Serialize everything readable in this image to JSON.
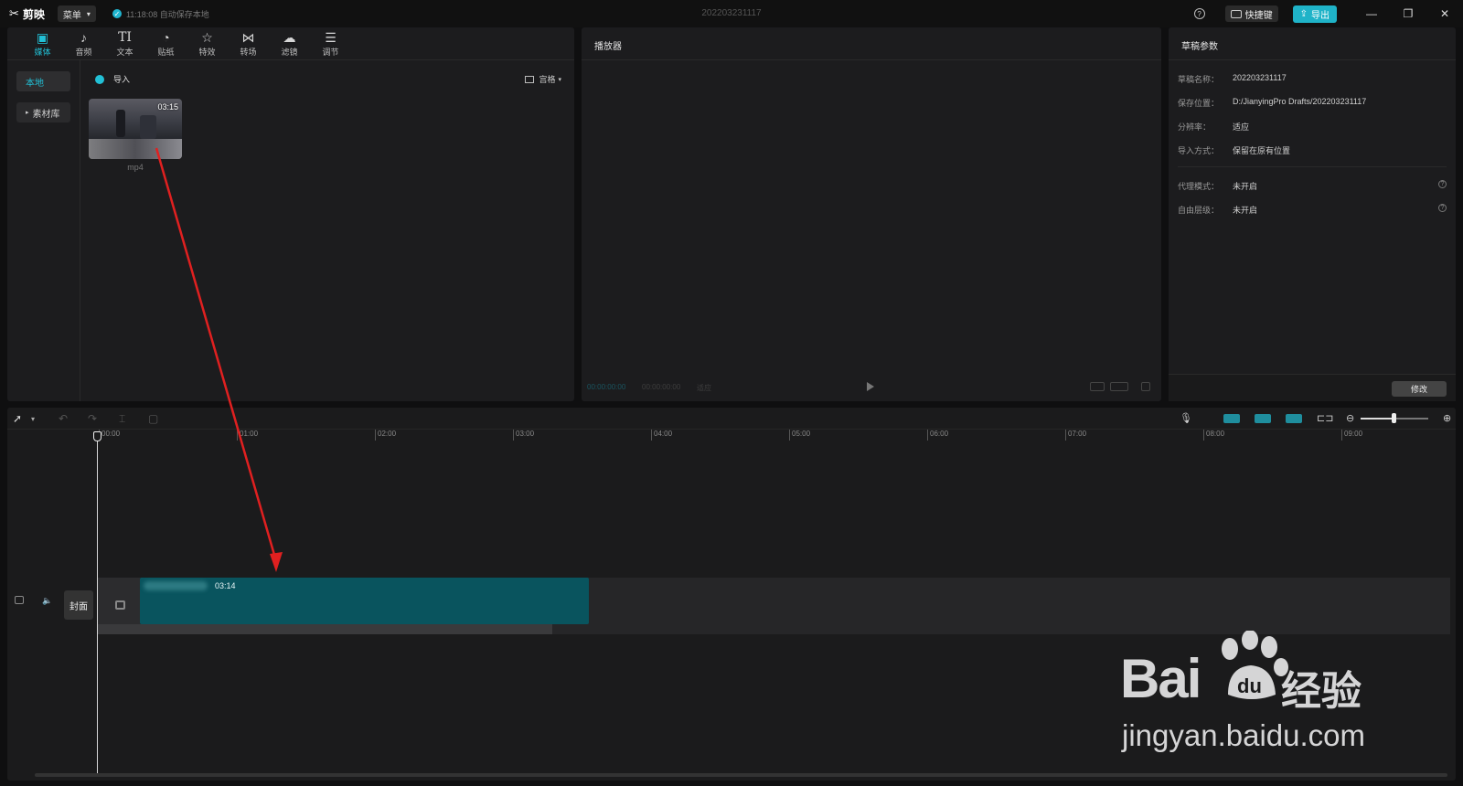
{
  "titlebar": {
    "app_name": "剪映",
    "menu_label": "菜单",
    "autosave_text": "11:18:08 自动保存本地",
    "doc_title": "202203231117",
    "shortcut_label": "快捷键",
    "export_label": "导出"
  },
  "toolbar": {
    "tabs": [
      {
        "label": "媒体",
        "icon": "media-icon"
      },
      {
        "label": "音频",
        "icon": "audio-icon"
      },
      {
        "label": "文本",
        "icon": "text-icon"
      },
      {
        "label": "贴纸",
        "icon": "sticker-icon"
      },
      {
        "label": "特效",
        "icon": "effects-icon"
      },
      {
        "label": "转场",
        "icon": "transition-icon"
      },
      {
        "label": "滤镜",
        "icon": "filter-icon"
      },
      {
        "label": "调节",
        "icon": "adjust-icon"
      }
    ]
  },
  "media": {
    "side_local": "本地",
    "side_library": "素材库",
    "import_label": "导入",
    "view_label": "宫格",
    "clip_duration": "03:15",
    "clip_name": "mp4"
  },
  "player": {
    "title": "播放器",
    "time_current": "00:00:00:00",
    "time_total": "00:00:00:00",
    "ratio_label": "适应"
  },
  "draft": {
    "title": "草稿参数",
    "fields": [
      {
        "key": "草稿名称：",
        "value": "202203231117"
      },
      {
        "key": "保存位置：",
        "value": "D:/JianyingPro Drafts/202203231117"
      },
      {
        "key": "分辨率：",
        "value": "适应"
      },
      {
        "key": "导入方式：",
        "value": "保留在原有位置"
      },
      {
        "key": "代理模式：",
        "value": "未开启"
      },
      {
        "key": "自由层级：",
        "value": "未开启"
      }
    ],
    "modify_label": "修改"
  },
  "timeline": {
    "ticks": [
      "00:00",
      "01:00",
      "02:00",
      "03:00",
      "04:00",
      "05:00",
      "06:00",
      "07:00",
      "08:00",
      "09:00"
    ],
    "cover_label": "封面",
    "clip_duration": "03:14"
  },
  "watermark": {
    "brand": "Bai",
    "brand_cn": "经验",
    "url": "jingyan.baidu.com"
  },
  "colors": {
    "accent": "#22c0d6",
    "clip": "#09545e",
    "annotation_arrow": "#e02020"
  }
}
